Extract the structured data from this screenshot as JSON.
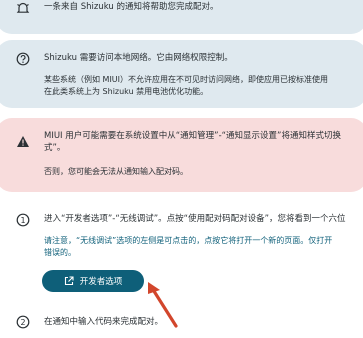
{
  "top_card": {
    "text": "一条来自 Shizuku 的通知将帮助您完成配对。",
    "icon": "bell-icon"
  },
  "network_card": {
    "icon": "help-circle-icon",
    "title": "Shizuku 需要访问本地网络。它由网络权限控制。",
    "body_line1": "某些系统（例如 MIUI）不允许应用在不可见时访问网络，即使应用已按标准使用",
    "body_line2": "在此类系统上为 Shizuku 禁用电池优化功能。"
  },
  "warning_card": {
    "icon": "warning-icon",
    "title_line1": "MIUI 用户可能需要在系统设置中从“通知管理”-“通知显示设置”将通知样式切换",
    "title_line2": "式”。",
    "body": "否则，您可能会无法从通知输入配对码。"
  },
  "step1": {
    "number": "1",
    "text": "进入“开发者选项”-“无线调试”。点按“使用配对码配对设备”，您将看到一个六位",
    "note_line1": "请注意，“无线调试”选项的左侧是可点击的，点按它将打开一个新的页面。仅打开",
    "note_line2": "错误的。",
    "button_label": "开发者选项",
    "button_icon": "open-external-icon"
  },
  "step2": {
    "number": "2",
    "text": "在通知中输入代码来完成配对。"
  },
  "colors": {
    "info_card_bg": "#dfe9ef",
    "warning_card_bg": "#f8dcdc",
    "primary": "#0e5f79",
    "accent_arrow": "#d2462c"
  }
}
